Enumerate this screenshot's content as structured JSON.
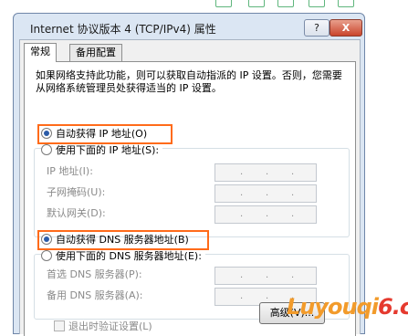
{
  "window": {
    "title": "Internet 协议版本 4 (TCP/IPv4) 属性",
    "help_label": "?",
    "close_label": "X"
  },
  "tabs": [
    {
      "label": "常规",
      "active": true
    },
    {
      "label": "备用配置",
      "active": false
    }
  ],
  "description": "如果网络支持此功能，则可以获取自动指派的 IP 设置。否则，您需要从网络系统管理员处获得适当的 IP 设置。",
  "ip_section": {
    "auto_label": "自动获得 IP 地址(O)",
    "manual_label": "使用下面的 IP 地址(S):",
    "fields": [
      {
        "label": "IP 地址(I):",
        "value": ""
      },
      {
        "label": "子网掩码(U):",
        "value": ""
      },
      {
        "label": "默认网关(D):",
        "value": ""
      }
    ]
  },
  "dns_section": {
    "auto_label": "自动获得 DNS 服务器地址(B)",
    "manual_label": "使用下面的 DNS 服务器地址(E):",
    "fields": [
      {
        "label": "首选 DNS 服务器(P):",
        "value": ""
      },
      {
        "label": "备用 DNS 服务器(A):",
        "value": ""
      }
    ]
  },
  "validate_label": "退出时验证设置(L)",
  "advanced_label": "高级(V)...",
  "watermark": {
    "part1": "Luyouqi",
    "part2": "6.cn"
  },
  "colors": {
    "highlight": "#ff6b1a",
    "accent": "#2b5ca8"
  }
}
